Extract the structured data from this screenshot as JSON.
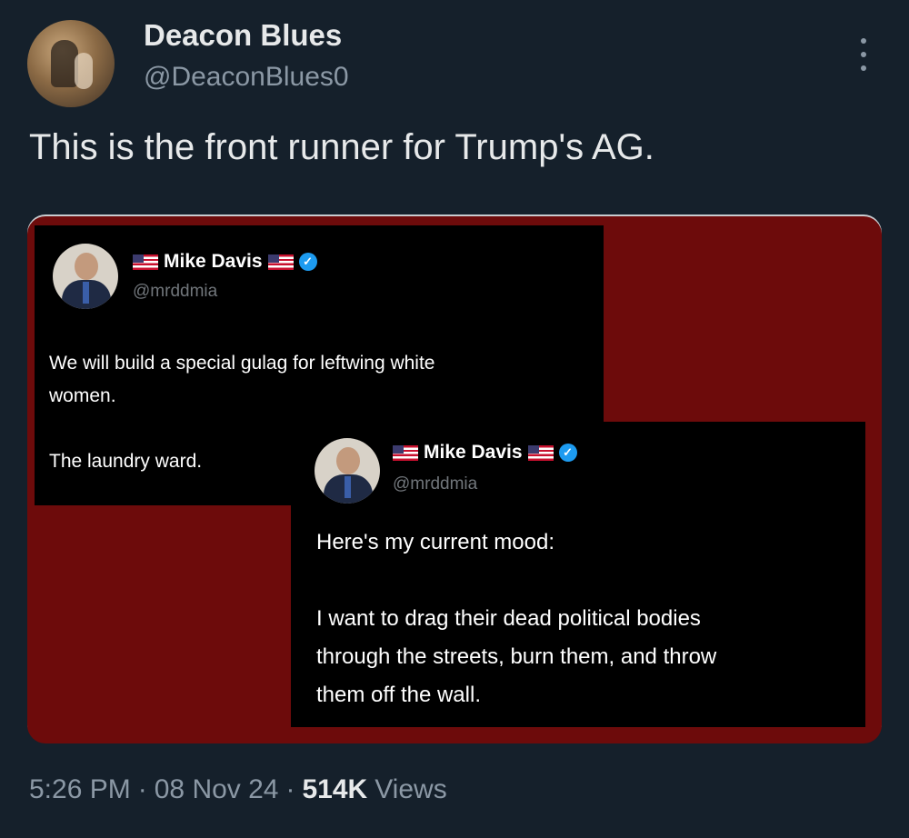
{
  "author": {
    "display_name": "Deacon Blues",
    "handle": "@DeaconBlues0"
  },
  "tweet": {
    "text": "This is the front runner for Trump's AG."
  },
  "embedded_tweets": [
    {
      "display_name": "Mike Davis",
      "handle": "@mrddmia",
      "paragraphs": [
        "We will build a special gulag for leftwing white",
        "women.",
        "",
        "The laundry ward."
      ]
    },
    {
      "display_name": "Mike Davis",
      "handle": "@mrddmia",
      "paragraphs": [
        "Here's my current mood:",
        "",
        "I want to drag their dead political bodies",
        "through the streets, burn them, and throw",
        "them off the wall."
      ]
    }
  ],
  "meta": {
    "time": "5:26 PM",
    "separator": "·",
    "date": "08 Nov 24",
    "views_count": "514K",
    "views_label": "Views"
  },
  "colors": {
    "background": "#15202b",
    "media_background": "#6d0b0b",
    "verified": "#1d9bf0"
  },
  "icons": [
    "more-icon",
    "us-flag-icon",
    "verified-badge-icon"
  ]
}
